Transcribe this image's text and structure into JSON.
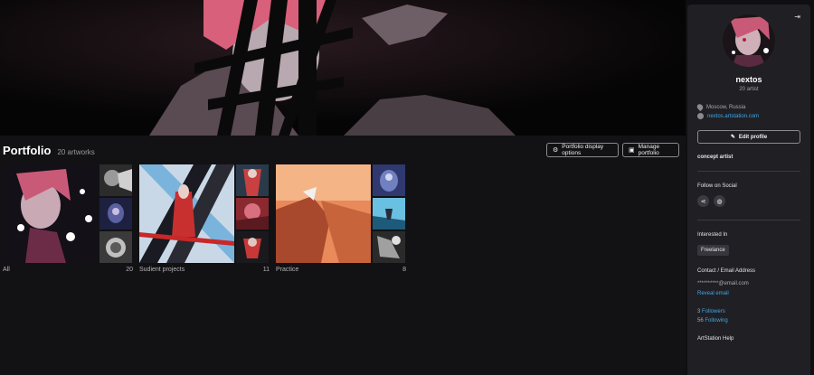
{
  "portfolio": {
    "title": "Portfolio",
    "count": "20 artworks",
    "display_options_label": "Portfolio display options",
    "manage_label": "Manage portfolio"
  },
  "albums": [
    {
      "name": "All",
      "count": "20"
    },
    {
      "name": "Sudient projects",
      "count": "11"
    },
    {
      "name": "Practice",
      "count": "8"
    }
  ],
  "profile": {
    "username": "nextos",
    "subtitle": "20 artist",
    "location": "Moscow, Russia",
    "website": "nextos.artstation.com",
    "edit_label": "Edit profile",
    "headline": "concept artist",
    "follow_social": "Follow on Social",
    "interested_in": "Interested In",
    "interest_chip": "Freelance",
    "contact_heading": "Contact / Email Address",
    "email": "**********@email.com",
    "reveal_email": "Reveal email",
    "followers_count": "3",
    "followers_label": "Followers",
    "following_count": "56",
    "following_label": "Following",
    "help": "ArtStation Help"
  },
  "icons": {
    "collapse": "collapse-arrow-icon",
    "settings": "gear-icon",
    "manage": "image-icon",
    "edit": "pencil-icon",
    "location": "location-pin-icon",
    "website": "globe-icon",
    "share": "share-icon",
    "globe": "globe-icon"
  },
  "colors": {
    "accent_link": "#3ea6ec",
    "sidebar_bg": "#202024",
    "page_bg": "#121214"
  }
}
